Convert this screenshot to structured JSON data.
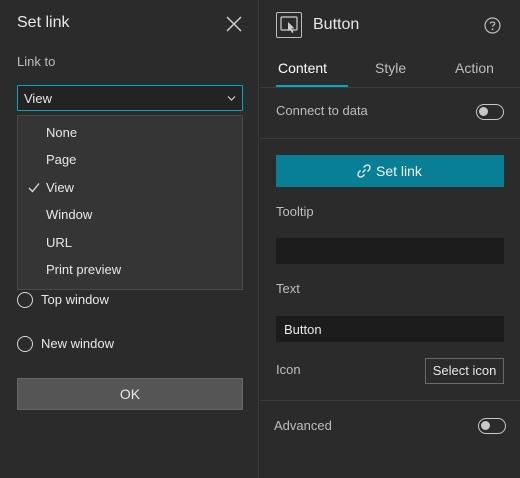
{
  "set_link_panel": {
    "title": "Set link",
    "link_to_label": "Link to",
    "selected_option": "View",
    "options": [
      {
        "label": "None",
        "selected": false
      },
      {
        "label": "Page",
        "selected": false
      },
      {
        "label": "View",
        "selected": true
      },
      {
        "label": "Window",
        "selected": false
      },
      {
        "label": "URL",
        "selected": false
      },
      {
        "label": "Print preview",
        "selected": false
      }
    ],
    "open_in": [
      {
        "label": "Top window"
      },
      {
        "label": "New window"
      }
    ],
    "ok_label": "OK"
  },
  "widget_panel": {
    "title": "Button",
    "tabs": [
      {
        "label": "Content",
        "active": true
      },
      {
        "label": "Style",
        "active": false
      },
      {
        "label": "Action",
        "active": false
      }
    ],
    "connect_to_data_label": "Connect to data",
    "connect_to_data_on": false,
    "set_link_label": "Set link",
    "tooltip_label": "Tooltip",
    "tooltip_value": "",
    "text_label": "Text",
    "text_value": "Button",
    "icon_label": "Icon",
    "select_icon_label": "Select icon",
    "advanced_label": "Advanced",
    "advanced_on": false
  },
  "colors": {
    "accent": "#00a8c8",
    "primary_button": "#087f95"
  },
  "icons": [
    "close-icon",
    "chevron-down-icon",
    "check-icon",
    "widget-button-icon",
    "help-icon",
    "link-icon"
  ]
}
